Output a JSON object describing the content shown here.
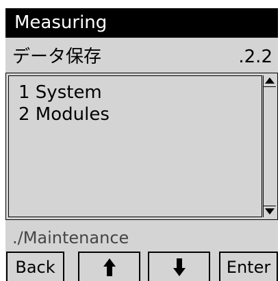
{
  "header": {
    "title": "Measuring"
  },
  "menu": {
    "title": "データ保存",
    "level": ".2.2"
  },
  "list": {
    "items": [
      {
        "label": "1 System"
      },
      {
        "label": "2 Modules"
      }
    ]
  },
  "scrollbar": {
    "up_icon": "scroll-up-arrow-icon",
    "down_icon": "scroll-down-arrow-icon"
  },
  "footer": {
    "path": "./Maintenance"
  },
  "softkeys": {
    "back_label": "Back",
    "up_icon": "arrow-up-icon",
    "down_icon": "arrow-down-icon",
    "enter_label": "Enter"
  },
  "colors": {
    "screen_background": "#d4d4d4",
    "title_bar": "#000000",
    "title_text": "#ffffff",
    "path_text": "#454545"
  }
}
